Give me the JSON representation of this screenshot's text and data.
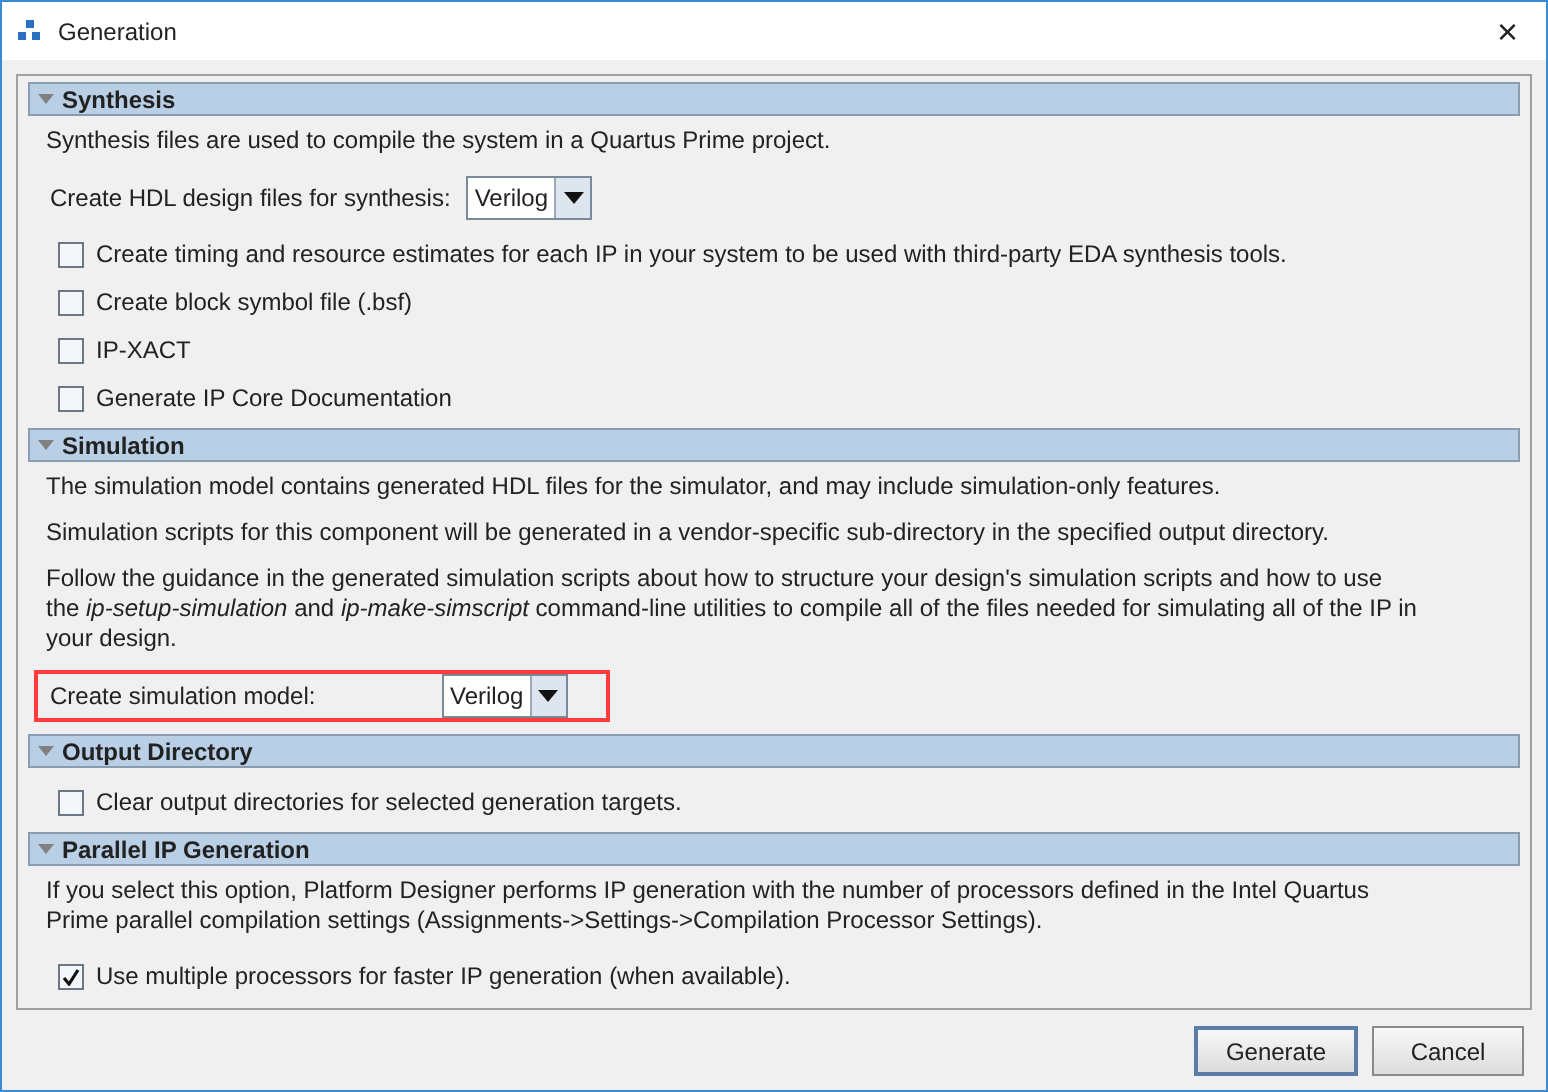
{
  "window": {
    "title": "Generation",
    "close": "×"
  },
  "sections": [
    {
      "title": "Synthesis",
      "expanded": true,
      "items": [
        {
          "kind": "text",
          "text": "Synthesis files are used to compile the system in a Quartus Prime project."
        },
        {
          "kind": "dropdown",
          "label": "Create HDL design files for synthesis:",
          "value": "Verilog",
          "highlighted": false
        },
        {
          "kind": "checkbox",
          "label": "Create timing and resource estimates for each IP in your system to be used with third-party EDA synthesis tools.",
          "checked": false
        },
        {
          "kind": "checkbox",
          "label": "Create block symbol file (.bsf)",
          "checked": false
        },
        {
          "kind": "checkbox",
          "label": "IP-XACT",
          "checked": false
        },
        {
          "kind": "checkbox",
          "label": "Generate IP Core Documentation",
          "checked": false
        }
      ]
    },
    {
      "title": "Simulation",
      "expanded": true,
      "items": [
        {
          "kind": "text",
          "text": "The simulation model contains generated HDL files for the simulator, and may include simulation-only features."
        },
        {
          "kind": "text",
          "text": "Simulation scripts for this component will be generated in a vendor-specific sub-directory in the specified output directory."
        },
        {
          "kind": "text",
          "text": "Follow the guidance in the generated simulation scripts about how to structure your design's simulation scripts and how to use the *ip-setup-simulation* and *ip-make-simscript* command-line utilities to compile all of the files needed for simulating all of the IP in your design."
        },
        {
          "kind": "dropdown",
          "label": "Create simulation model:",
          "value": "Verilog",
          "highlighted": true
        }
      ]
    },
    {
      "title": "Output Directory",
      "expanded": true,
      "items": [
        {
          "kind": "checkbox",
          "label": "Clear output directories for selected generation targets.",
          "checked": false
        }
      ]
    },
    {
      "title": "Parallel IP Generation",
      "expanded": true,
      "items": [
        {
          "kind": "text",
          "text": "If you select this option, Platform Designer performs IP generation with the number of processors defined in the Intel Quartus Prime parallel compilation settings (Assignments->Settings->Compilation Processor Settings)."
        },
        {
          "kind": "checkbox",
          "label": "Use multiple processors for faster IP generation (when available).",
          "checked": true
        }
      ]
    }
  ],
  "buttons": [
    {
      "label": "Generate",
      "default": true
    },
    {
      "label": "Cancel",
      "default": false
    }
  ]
}
